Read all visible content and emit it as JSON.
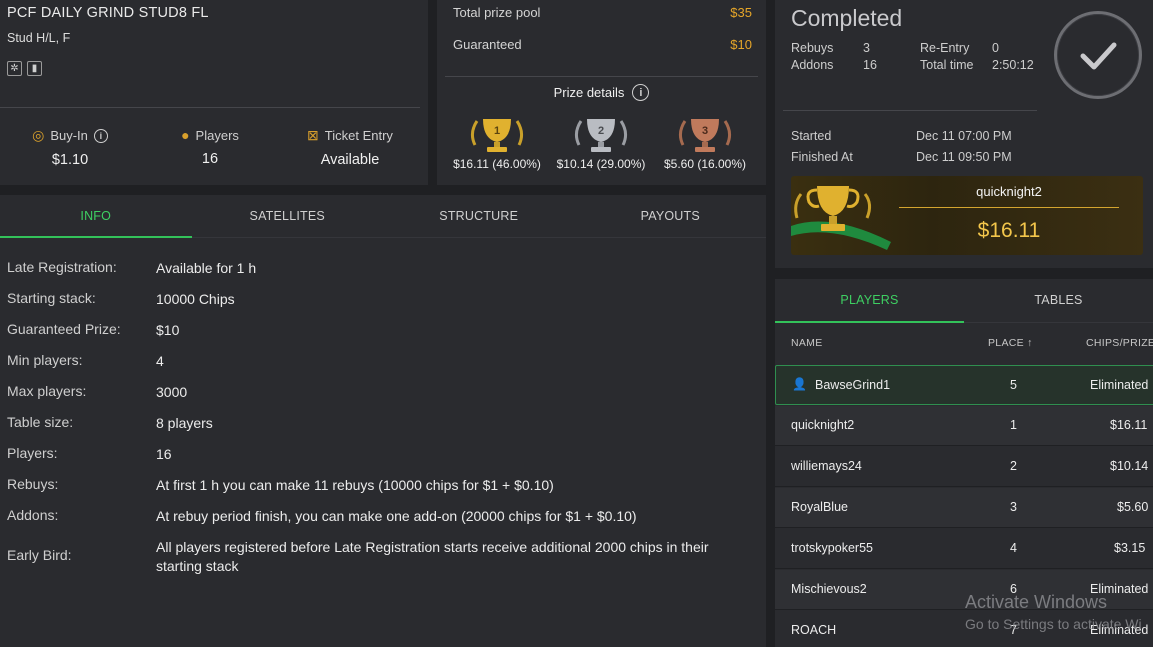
{
  "tournament": {
    "name": "PCF DAILY GRIND STUD8 FL",
    "game": "Stud H/L, F",
    "icons": [
      "chip-icon",
      "card-icon"
    ],
    "stats": [
      {
        "label": "Buy-In",
        "value": "$1.10",
        "icon": "chip-icon"
      },
      {
        "label": "Players",
        "value": "16",
        "icon": "person-icon"
      },
      {
        "label": "Ticket Entry",
        "value": "Available",
        "icon": "ticket-icon"
      }
    ]
  },
  "prize": {
    "pool_label": "Total prize pool",
    "pool_value": "$35",
    "guaranteed_label": "Guaranteed",
    "guaranteed_value": "$10",
    "details_label": "Prize details",
    "cups": [
      {
        "place": "1",
        "amount": "$16.11 (46.00%)",
        "color": "#e0b12f"
      },
      {
        "place": "2",
        "amount": "$10.14 (29.00%)",
        "color": "#b9bcc2"
      },
      {
        "place": "3",
        "amount": "$5.60 (16.00%)",
        "color": "#c07a5c"
      }
    ]
  },
  "status": {
    "title": "Completed",
    "rebuys_label": "Rebuys",
    "rebuys_value": "3",
    "addons_label": "Addons",
    "addons_value": "16",
    "reentry_label": "Re-Entry",
    "reentry_value": "0",
    "totaltime_label": "Total time",
    "totaltime_value": "2:50:12",
    "started_label": "Started",
    "started_value": "Dec 11 07:00 PM",
    "finished_label": "Finished At",
    "finished_value": "Dec 11 09:50 PM",
    "winner_name": "quicknight2",
    "winner_amount": "$16.11"
  },
  "main_tabs": [
    "INFO",
    "SATELLITES",
    "STRUCTURE",
    "PAYOUTS"
  ],
  "info": [
    {
      "key": "Late Registration:",
      "value": "Available for 1 h"
    },
    {
      "key": "Starting stack:",
      "value": "10000 Chips"
    },
    {
      "key": "Guaranteed Prize:",
      "value": "$10"
    },
    {
      "key": "Min players:",
      "value": "4"
    },
    {
      "key": "Max players:",
      "value": "3000"
    },
    {
      "key": "Table size:",
      "value": "8 players"
    },
    {
      "key": "Players:",
      "value": "16"
    },
    {
      "key": "Rebuys:",
      "value": "At first 1 h you can make 11 rebuys (10000 chips for $1 + $0.10)"
    },
    {
      "key": "Addons:",
      "value": "At rebuy period finish, you can make one add-on (20000 chips for $1 + $0.10)"
    },
    {
      "key": "Early Bird:",
      "value": "All players registered before Late Registration starts receive additional 2000 chips in their starting stack"
    }
  ],
  "players_tabs": [
    "PLAYERS",
    "TABLES"
  ],
  "players_head": {
    "name": "NAME",
    "place": "PLACE ↑",
    "chips": "CHIPS/PRIZE"
  },
  "players": [
    {
      "name": "BawseGrind1",
      "place": "5",
      "prize": "Eliminated",
      "me": true
    },
    {
      "name": "quicknight2",
      "place": "1",
      "prize": "$16.11"
    },
    {
      "name": "williemays24",
      "place": "2",
      "prize": "$10.14"
    },
    {
      "name": "RoyalBlue",
      "place": "3",
      "prize": "$5.60"
    },
    {
      "name": "trotskypoker55",
      "place": "4",
      "prize": "$3.15"
    },
    {
      "name": "Mischievous2",
      "place": "6",
      "prize": "Eliminated"
    },
    {
      "name": "ROACH",
      "place": "7",
      "prize": "Eliminated"
    }
  ],
  "watermark": {
    "line1": "Activate Windows",
    "line2": "Go to Settings to activate Wi"
  }
}
